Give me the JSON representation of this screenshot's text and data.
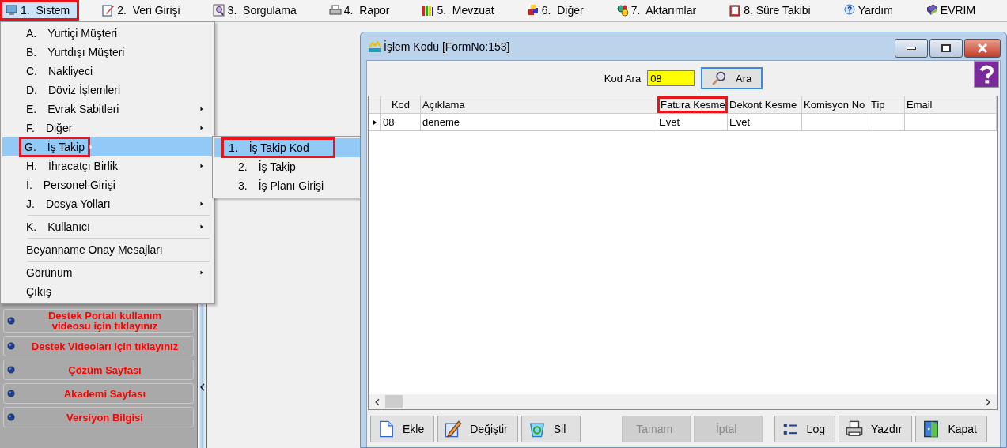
{
  "menubar": [
    {
      "label": "1.  Sistem",
      "selected": true,
      "highlighted": true
    },
    {
      "label": "2.  Veri Girişi",
      "selected": false,
      "highlighted": false
    },
    {
      "label": "3.  Sorgulama",
      "selected": false,
      "highlighted": false
    },
    {
      "label": "4.  Rapor",
      "selected": false,
      "highlighted": false
    },
    {
      "label": "5.  Mevzuat",
      "selected": false,
      "highlighted": false
    },
    {
      "label": "6.  Diğer",
      "selected": false,
      "highlighted": false
    },
    {
      "label": "7.  Aktarımlar",
      "selected": false,
      "highlighted": false
    },
    {
      "label": "8. Süre Takibi",
      "selected": false,
      "highlighted": false
    },
    {
      "label": "Yardım",
      "selected": false,
      "highlighted": false
    },
    {
      "label": "EVRIM",
      "selected": false,
      "highlighted": false
    }
  ],
  "menu": [
    {
      "kind": "item",
      "key": "A.",
      "label": "Yurtiçi Müşteri",
      "submenu": false,
      "selected": false,
      "highlighted": false
    },
    {
      "kind": "item",
      "key": "B.",
      "label": "Yurtdışı Müşteri",
      "submenu": false,
      "selected": false,
      "highlighted": false
    },
    {
      "kind": "item",
      "key": "C.",
      "label": "Nakliyeci",
      "submenu": false,
      "selected": false,
      "highlighted": false
    },
    {
      "kind": "item",
      "key": "D.",
      "label": "Döviz İşlemleri",
      "submenu": false,
      "selected": false,
      "highlighted": false
    },
    {
      "kind": "item",
      "key": "E.",
      "label": "Evrak Sabitleri",
      "submenu": true,
      "selected": false,
      "highlighted": false
    },
    {
      "kind": "item",
      "key": "F.",
      "label": "Diğer",
      "submenu": true,
      "selected": false,
      "highlighted": false
    },
    {
      "kind": "item",
      "key": "G.",
      "label": "İş Takip",
      "submenu": true,
      "selected": true,
      "highlighted": true
    },
    {
      "kind": "item",
      "key": "H.",
      "label": "İhracatçı Birlik",
      "submenu": true,
      "selected": false,
      "highlighted": false
    },
    {
      "kind": "item",
      "key": "İ.",
      "label": "Personel Girişi",
      "submenu": false,
      "selected": false,
      "highlighted": false
    },
    {
      "kind": "item",
      "key": "J.",
      "label": "Dosya Yolları",
      "submenu": true,
      "selected": false,
      "highlighted": false
    },
    {
      "kind": "separator"
    },
    {
      "kind": "item",
      "key": "K.",
      "label": "Kullanıcı",
      "submenu": true,
      "selected": false,
      "highlighted": false
    },
    {
      "kind": "separator"
    },
    {
      "kind": "item",
      "label": "Beyanname Onay Mesajları",
      "submenu": false,
      "selected": false,
      "highlighted": false
    },
    {
      "kind": "separator"
    },
    {
      "kind": "item",
      "label": "Görünüm",
      "submenu": true,
      "selected": false,
      "highlighted": false
    },
    {
      "kind": "item",
      "label": "Çıkış",
      "submenu": false,
      "selected": false,
      "highlighted": false
    }
  ],
  "submenu": [
    {
      "key": "1.",
      "label": "İş Takip Kod",
      "selected": true,
      "highlighted": true
    },
    {
      "key": "2.",
      "label": "İş Takip",
      "selected": false,
      "highlighted": false
    },
    {
      "key": "3.",
      "label": "İş Planı Girişi",
      "selected": false,
      "highlighted": false
    }
  ],
  "sidebar": {
    "links": [
      "Destek Portalı kullanım videosu için tıklayınız",
      "Destek Videoları için tıklayınız",
      "Çözüm Sayfası",
      "Akademi Sayfası",
      "Versiyon Bilgisi"
    ]
  },
  "window": {
    "title": "İşlem Kodu [FormNo:153]",
    "search": {
      "label": "Kod Ara",
      "value": "08",
      "button": "Ara"
    },
    "table": {
      "columns": [
        {
          "label": "Kod",
          "highlighted": false
        },
        {
          "label": "Açıklama",
          "highlighted": false
        },
        {
          "label": "Fatura Kesme",
          "highlighted": true
        },
        {
          "label": "Dekont Kesme",
          "highlighted": false
        },
        {
          "label": "Komisyon No",
          "highlighted": false
        },
        {
          "label": "Tip",
          "highlighted": false
        },
        {
          "label": "Email",
          "highlighted": false
        }
      ],
      "rows": [
        {
          "current": true,
          "cells": [
            "08",
            "deneme",
            "Evet",
            "Evet",
            null,
            null,
            null
          ]
        }
      ]
    },
    "button_groups": [
      [
        {
          "label": "Ekle",
          "disabled": false
        },
        {
          "label": "Değiştir",
          "disabled": false
        },
        {
          "label": "Sil",
          "disabled": false
        }
      ],
      [
        {
          "label": "Tamam",
          "disabled": true
        },
        {
          "label": "İptal",
          "disabled": true
        }
      ],
      [
        {
          "label": "Log",
          "disabled": false
        },
        {
          "label": "Yazdır",
          "disabled": false
        },
        {
          "label": "Kapat",
          "disabled": false
        }
      ]
    ]
  }
}
